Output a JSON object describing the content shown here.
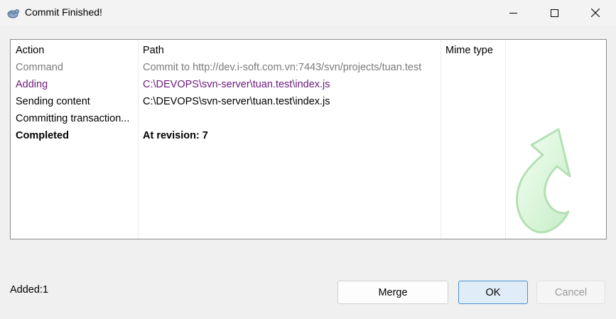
{
  "window": {
    "title": "Commit Finished!",
    "app_icon": "tortoise-svn-icon",
    "controls": [
      "minimize-icon",
      "maximize-icon",
      "close-icon"
    ]
  },
  "list": {
    "columns": [
      "Action",
      "Path",
      "Mime type"
    ],
    "rows": [
      {
        "action": "Command",
        "path": "Commit to http://dev.i-soft.com.vn:7443/svn/projects/tuan.test",
        "mime": "",
        "style": "gray"
      },
      {
        "action": "Adding",
        "path": "C:\\DEVOPS\\svn-server\\tuan.test\\index.js",
        "mime": "",
        "style": "purple"
      },
      {
        "action": "Sending content",
        "path": "C:\\DEVOPS\\svn-server\\tuan.test\\index.js",
        "mime": "",
        "style": "normal"
      },
      {
        "action": "Committing transaction...",
        "path": "",
        "mime": "",
        "style": "normal"
      },
      {
        "action": "Completed",
        "path": "At revision: 7",
        "mime": "",
        "style": "bold"
      }
    ],
    "watermark_icon": "green-curved-arrow-icon"
  },
  "status": {
    "text": "Added:1"
  },
  "buttons": {
    "merge": "Merge",
    "ok": "OK",
    "cancel": "Cancel"
  },
  "colors": {
    "purple": "#6a1b7a",
    "gray": "#7a7a7a",
    "ok_border": "#4a8fd6",
    "arrow_green": "#d8f5d8"
  }
}
